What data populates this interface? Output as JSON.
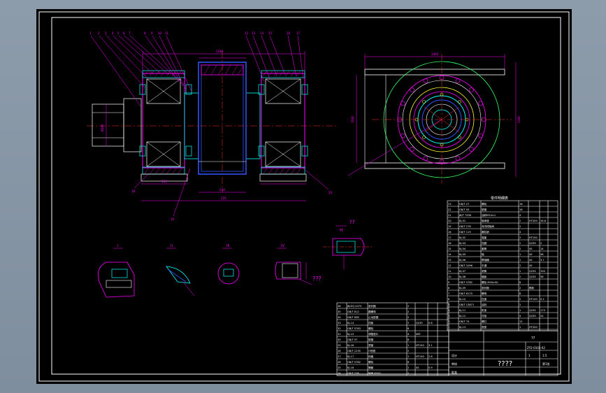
{
  "drawing": {
    "background": "#000000",
    "frame_color": "#ffffff",
    "colors": {
      "outline": "#ffffff",
      "section": "#ff00ff",
      "hatch": "#00ffff",
      "center": "#ff3030",
      "dimension": "#ff00ff",
      "circle_green": "#33ff66",
      "circle_yellow": "#ffff33",
      "circle_blue": "#3355ff"
    },
    "dimension_labels": {
      "top_width": "1180",
      "left_height": "Ø280",
      "bottom_a": "155",
      "bottom_b": "230",
      "bottom_c": "225",
      "end_view_width": "1400",
      "end_view_height": "1180",
      "end_view_diam": "1340"
    },
    "detail_view_labels": [
      "I",
      "II",
      "III",
      "IV",
      "H"
    ],
    "detail_callout": "??",
    "detail_text": "???",
    "parts_table_title": "零件明细表",
    "parts_rows": [
      [
        "23",
        "GB/T 27",
        "螺栓",
        "16",
        "",
        ""
      ],
      [
        "22",
        "GB/T 93",
        "垫圈",
        "16",
        "",
        ""
      ],
      [
        "21",
        "JB/T 7939",
        "油杯M10×1",
        "4",
        "",
        ""
      ],
      [
        "20",
        "KJ-01",
        "轴承座",
        "2",
        "HT200",
        "16.6"
      ],
      [
        "19",
        "GB/T 276",
        "深沟球轴承",
        "2",
        "",
        ""
      ],
      [
        "18",
        "GB/T 119",
        "圆柱销",
        "4",
        "",
        ""
      ],
      [
        "17",
        "KJ-02",
        "端盖",
        "2",
        "HT150",
        ""
      ],
      [
        "16",
        "KJ-03",
        "挡圈",
        "2",
        "Q235",
        "2"
      ],
      [
        "15",
        "KJ-04",
        "套筒",
        "2",
        "45",
        "14"
      ],
      [
        "14",
        "KJ-05",
        "轴",
        "1",
        "45",
        "58"
      ],
      [
        "13",
        "KJ-06",
        "联轴器",
        "1",
        "45",
        "3.7"
      ],
      [
        "12",
        "GB/T 1096",
        "平键",
        "2",
        "45",
        ""
      ],
      [
        "11",
        "KJ-07",
        "滚筒",
        "1",
        "Q235",
        "190"
      ],
      [
        "10",
        "KJ-08",
        "辐板",
        "2",
        "Q235",
        "36"
      ],
      [
        "9",
        "GB/T 5782",
        "螺栓 M16×50",
        "8",
        "",
        ""
      ],
      [
        "8",
        "KJ-09",
        "密封圈",
        "2",
        "橡胶",
        ""
      ],
      [
        "7",
        "GB/T 6170",
        "螺母",
        "8",
        "",
        ""
      ],
      [
        "6",
        "KJ-10",
        "压盖",
        "2",
        "HT150",
        "5.2"
      ],
      [
        "5",
        "GB/T 13871",
        "油封",
        "2",
        "",
        ""
      ],
      [
        "4",
        "KJ-11",
        "机架",
        "1",
        "Q235",
        "175"
      ],
      [
        "3",
        "KJ-12",
        "衬板",
        "4",
        "Q235",
        "24"
      ],
      [
        "2",
        "GB/T 70",
        "螺钉",
        "12",
        "",
        ""
      ],
      [
        "1",
        "KJ-13",
        "底座",
        "1",
        "HT200",
        ""
      ]
    ],
    "left_table_rows": [
      [
        "36",
        "JB/ZQ 4373",
        "密封圈",
        "2",
        "",
        ""
      ],
      [
        "35",
        "GB/T 812",
        "圆螺母",
        "2",
        "",
        ""
      ],
      [
        "34",
        "GB/T 858",
        "止动垫圈",
        "2",
        "",
        ""
      ],
      [
        "33",
        "KJ-14",
        "挡板",
        "2",
        "Q235",
        "0.8"
      ],
      [
        "32",
        "GB/T 5783",
        "螺栓",
        "6",
        "",
        ""
      ],
      [
        "31",
        "KJ-15",
        "调整垫片",
        "4",
        "08F",
        ""
      ],
      [
        "30",
        "GB/T 97",
        "垫圈",
        "6",
        "",
        ""
      ],
      [
        "29",
        "KJ-16",
        "透盖",
        "1",
        "HT150",
        "3.1"
      ],
      [
        "28",
        "GB/T 1235",
        "O形圈",
        "2",
        "",
        ""
      ],
      [
        "27",
        "KJ-17",
        "闷盖",
        "1",
        "HT150",
        "2.6"
      ],
      [
        "26",
        "GB/T 5782",
        "螺栓",
        "8",
        "",
        ""
      ],
      [
        "25",
        "KJ-18",
        "隔套",
        "2",
        "45",
        "0.9"
      ],
      [
        "24",
        "GB/T 276",
        "轴承 6320",
        "2",
        "",
        ""
      ]
    ],
    "title_block": {
      "drawing_name": "????",
      "code": "ZY2-0103-02",
      "scale": "1:5",
      "sheet": "第1张",
      "mass": "1",
      "designer": "设计",
      "checker": "审核",
      "approver": "批准",
      "unit": "??"
    }
  }
}
